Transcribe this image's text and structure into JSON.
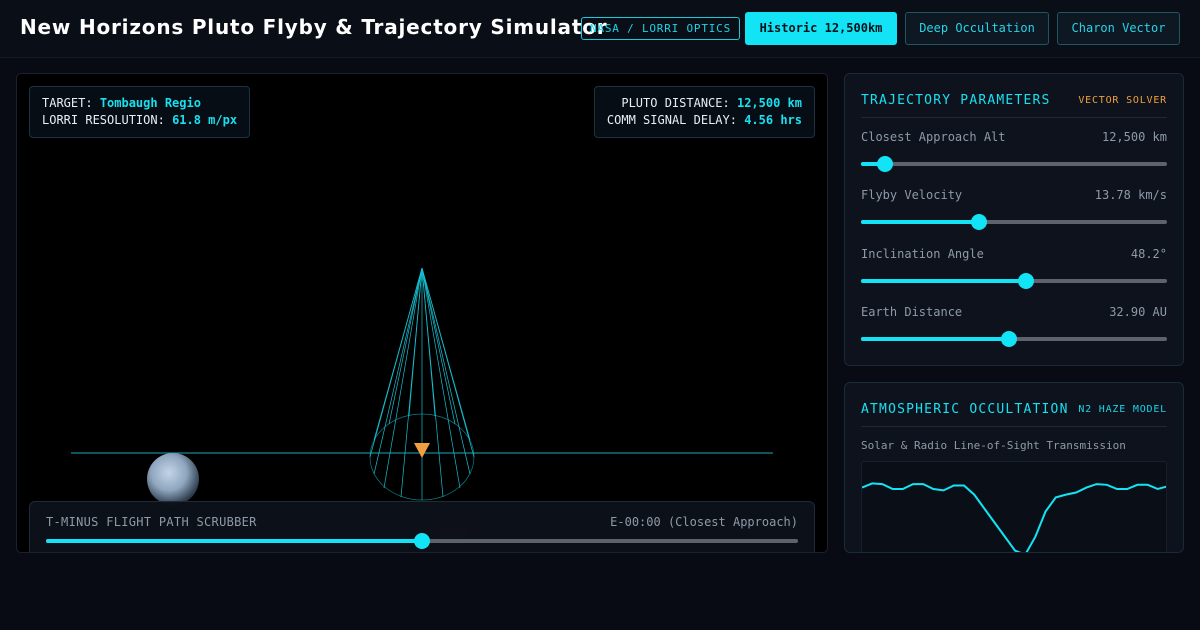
{
  "header": {
    "title": "New Horizons Pluto Flyby & Trajectory Simulator",
    "badge": "NASA / LORRI OPTICS",
    "modes": [
      {
        "label": "Historic 12,500km",
        "active": true
      },
      {
        "label": "Deep Occultation",
        "active": false
      },
      {
        "label": "Charon Vector",
        "active": false
      }
    ]
  },
  "hud": {
    "target_label": "TARGET:",
    "target_value": "Tombaugh Regio",
    "resolution_label": "LORRI RESOLUTION:",
    "resolution_value": "61.8 m/px",
    "distance_label": "PLUTO DISTANCE:",
    "distance_value": "12,500 km",
    "delay_label": "COMM SIGNAL DELAY:",
    "delay_value": "4.56 hrs"
  },
  "scrubber": {
    "label": "T-MINUS FLIGHT PATH SCRUBBER",
    "time": "E-00:00 (Closest Approach)",
    "progress": 0.5
  },
  "trajectory": {
    "title": "TRAJECTORY PARAMETERS",
    "tag": "VECTOR SOLVER",
    "params": [
      {
        "label": "Closest Approach Alt",
        "value": "12,500 km",
        "fraction": 0.08
      },
      {
        "label": "Flyby Velocity",
        "value": "13.78 km/s",
        "fraction": 0.385
      },
      {
        "label": "Inclination Angle",
        "value": "48.2°",
        "fraction": 0.54
      },
      {
        "label": "Earth Distance",
        "value": "32.90 AU",
        "fraction": 0.485
      }
    ]
  },
  "occultation": {
    "title": "ATMOSPHERIC OCCULTATION",
    "tag": "N2 HAZE MODEL",
    "subtitle": "Solar & Radio Line-of-Sight Transmission"
  },
  "chart_data": {
    "type": "line",
    "title": "Solar & Radio Line-of-Sight Transmission",
    "x": [
      0,
      1,
      2,
      3,
      4,
      5,
      6,
      7,
      8,
      9,
      10,
      11,
      12,
      13,
      14,
      15,
      16,
      17,
      18,
      19,
      20,
      21,
      22,
      23,
      24,
      25,
      26,
      27,
      28,
      29,
      30
    ],
    "series": [
      {
        "values": [
          0.92,
          0.98,
          0.97,
          0.9,
          0.9,
          0.97,
          0.97,
          0.9,
          0.88,
          0.95,
          0.95,
          0.82,
          0.62,
          0.42,
          0.22,
          0.02,
          -0.04,
          0.22,
          0.58,
          0.78,
          0.82,
          0.85,
          0.92,
          0.97,
          0.96,
          0.9,
          0.9,
          0.96,
          0.96,
          0.9,
          0.94
        ]
      }
    ],
    "ylim": [
      -0.2,
      1.2
    ],
    "grid": false
  },
  "colors": {
    "accent": "#12e4f5",
    "warning": "#f0a040",
    "background": "#080b13"
  }
}
